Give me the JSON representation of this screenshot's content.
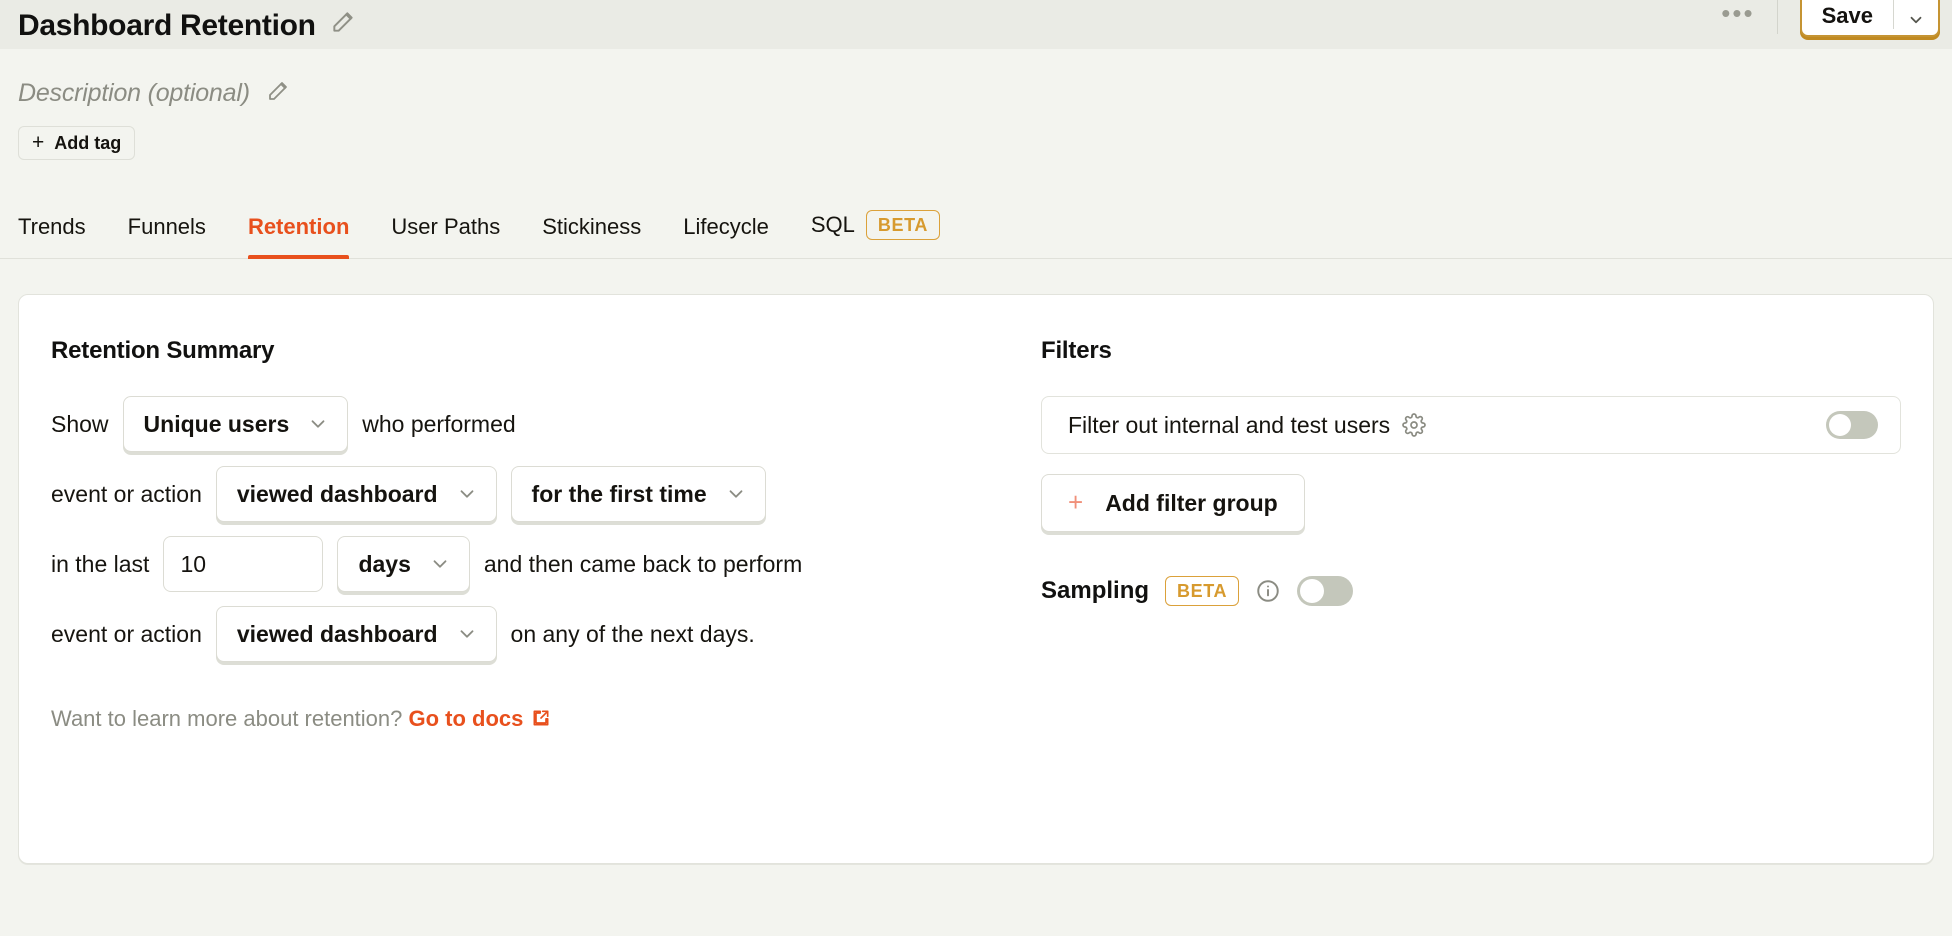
{
  "topbar": {
    "title": "Dashboard Retention",
    "edit_icon": "pencil-icon",
    "more_icon": "ellipsis-icon",
    "save_label": "Save",
    "save_caret_icon": "chevron-down-icon"
  },
  "meta": {
    "description_placeholder": "Description (optional)",
    "description_edit_icon": "pencil-icon",
    "add_tag_label": "Add tag",
    "add_tag_icon": "plus-icon"
  },
  "tabs": [
    {
      "label": "Trends",
      "active": false
    },
    {
      "label": "Funnels",
      "active": false
    },
    {
      "label": "Retention",
      "active": true
    },
    {
      "label": "User Paths",
      "active": false
    },
    {
      "label": "Stickiness",
      "active": false
    },
    {
      "label": "Lifecycle",
      "active": false
    },
    {
      "label": "SQL",
      "active": false,
      "badge": "BETA"
    }
  ],
  "retention_summary": {
    "title": "Retention Summary",
    "row1": {
      "prefix": "Show",
      "target_entity": "Unique users",
      "suffix": "who performed"
    },
    "row2": {
      "prefix": "event or action",
      "start_event": "viewed dashboard",
      "recurrence": "for the first time"
    },
    "row3": {
      "prefix": "in the last",
      "period_count": "10",
      "period_unit": "days",
      "suffix": "and then came back to perform"
    },
    "row4": {
      "prefix": "event or action",
      "return_event": "viewed dashboard",
      "suffix": "on any of the next days."
    },
    "docs_prefix": "Want to learn more about retention?",
    "docs_link": "Go to docs",
    "docs_link_icon": "external-link-icon"
  },
  "filters": {
    "title": "Filters",
    "test_accounts_label": "Filter out internal and test users",
    "test_accounts_gear_icon": "gear-icon",
    "test_accounts_enabled": false,
    "add_filter_group_label": "Add filter group",
    "add_filter_group_icon": "plus-icon",
    "sampling_label": "Sampling",
    "sampling_badge": "BETA",
    "sampling_info_icon": "info-circle-icon",
    "sampling_enabled": false
  },
  "colors": {
    "accent_orange": "#e8501d",
    "beta_amber": "#d79a2e",
    "save_border": "#c59433",
    "plus_salmon": "#f0907a",
    "page_bg": "#f3f4ef",
    "topbar_bg": "#eaebe5",
    "card_bg": "#ffffff",
    "toggle_off": "#c4c7bb",
    "muted_text": "#8b8c83"
  }
}
